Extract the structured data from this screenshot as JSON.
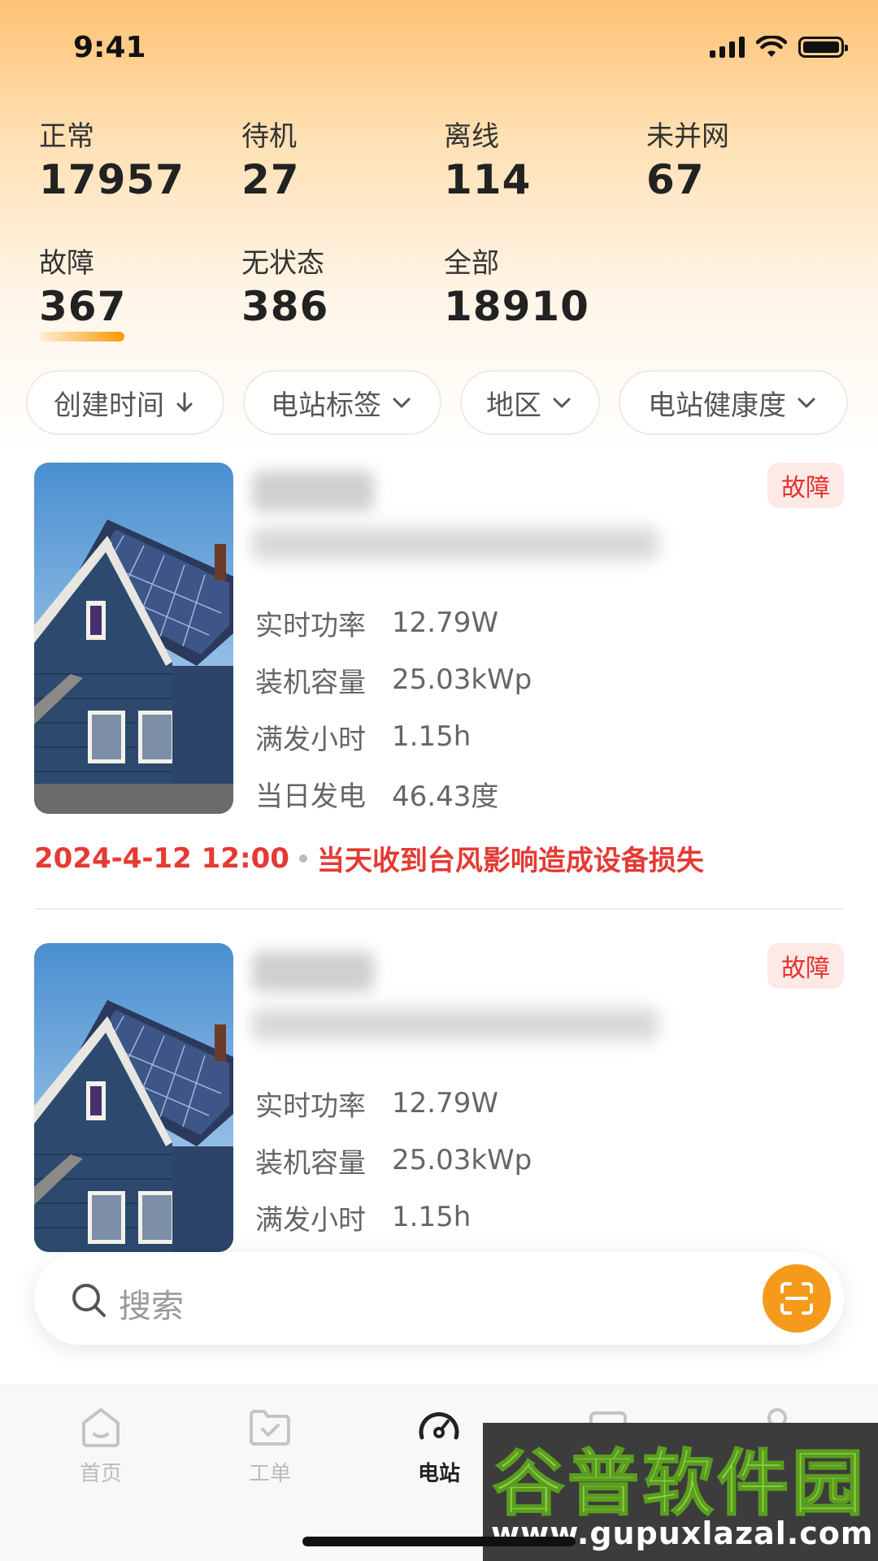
{
  "status_bar": {
    "time": "9:41"
  },
  "stats": [
    {
      "label": "正常",
      "value": "17957"
    },
    {
      "label": "待机",
      "value": "27"
    },
    {
      "label": "离线",
      "value": "114"
    },
    {
      "label": "未并网",
      "value": "67"
    },
    {
      "label": "故障",
      "value": "367"
    },
    {
      "label": "无状态",
      "value": "386"
    },
    {
      "label": "全部",
      "value": "18910"
    }
  ],
  "selected_stat": "故障",
  "filters": [
    {
      "label": "创建时间",
      "icon": "arrow-down-icon"
    },
    {
      "label": "电站标签",
      "icon": "chevron-down-icon"
    },
    {
      "label": "地区",
      "icon": "chevron-down-icon"
    },
    {
      "label": "电站健康度",
      "icon": "chevron-down-icon"
    }
  ],
  "stations": [
    {
      "status_badge": "故障",
      "metrics": [
        {
          "label": "实时功率",
          "value": "12.79W"
        },
        {
          "label": "装机容量",
          "value": "25.03kWp"
        },
        {
          "label": "满发小时",
          "value": "1.15h"
        },
        {
          "label": "当日发电",
          "value": "46.43度"
        }
      ],
      "event_time": "2024-4-12 12:00",
      "event_text": "当天收到台风影响造成设备损失"
    },
    {
      "status_badge": "故障",
      "metrics": [
        {
          "label": "实时功率",
          "value": "12.79W"
        },
        {
          "label": "装机容量",
          "value": "25.03kWp"
        },
        {
          "label": "满发小时",
          "value": "1.15h"
        }
      ]
    }
  ],
  "search": {
    "placeholder": "搜索"
  },
  "tabs": [
    {
      "label": "首页",
      "icon": "home-icon",
      "active": false
    },
    {
      "label": "工单",
      "icon": "work-order-icon",
      "active": false
    },
    {
      "label": "电站",
      "icon": "dashboard-icon",
      "active": true
    },
    {
      "label": "",
      "icon": "device-icon",
      "active": false
    },
    {
      "label": "",
      "icon": "profile-icon",
      "active": false
    }
  ],
  "watermark": {
    "title": "谷普软件园",
    "url": "www.gupuxlazal.com"
  },
  "colors": {
    "accent": "#f59a1b",
    "fault": "#e5322d",
    "badge_bg": "#fde9e6"
  }
}
